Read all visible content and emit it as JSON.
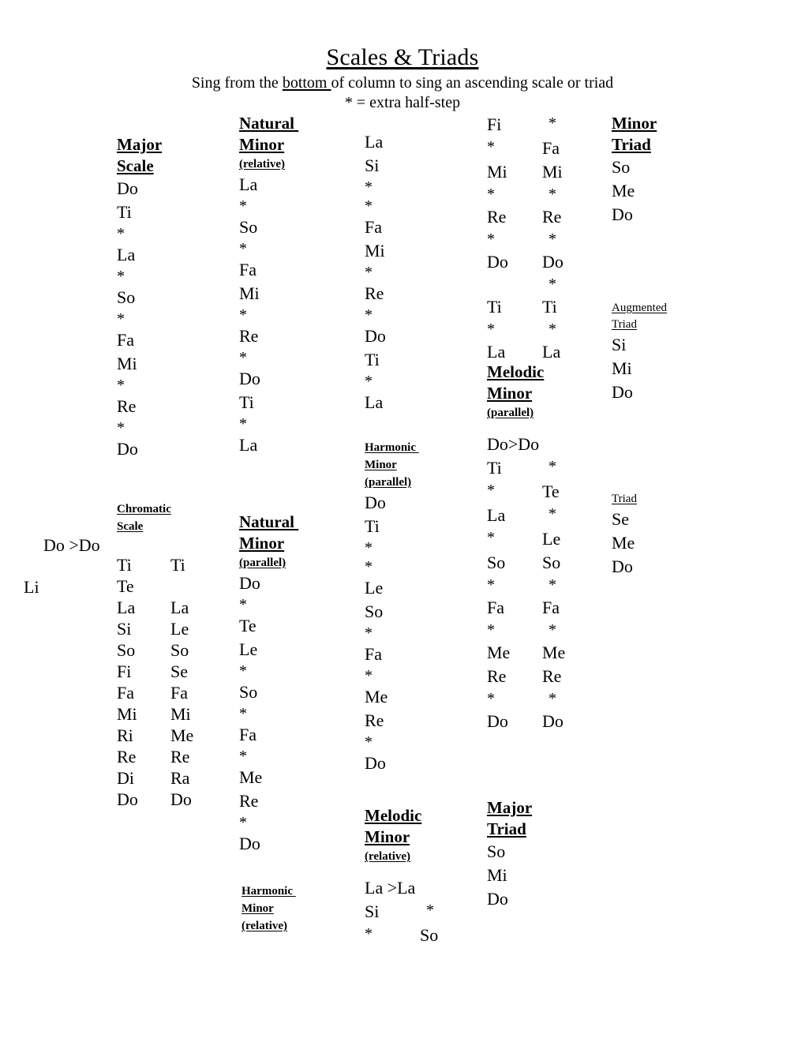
{
  "header": {
    "title": "Scales & Triads",
    "subtitle_pre": "Sing from the ",
    "subtitle_underline": "bottom ",
    "subtitle_post": "of column to sing an ascending scale or triad",
    "note": "* = extra half-step"
  },
  "col1": {
    "major_scale": {
      "title_line1": "Major",
      "title_line2": "Scale",
      "syllables": [
        "Do",
        "Ti",
        "*",
        "La",
        "*",
        "So",
        "*",
        "Fa",
        "Mi",
        "*",
        "Re",
        "*",
        "Do"
      ]
    },
    "chromatic_scale": {
      "title_line1": "Chromatic",
      "title_line2": "Scale",
      "range_label": "Do >Do",
      "side_label": "Li",
      "rows": [
        [
          "Ti",
          "Ti"
        ],
        [
          "Te",
          ""
        ],
        [
          "La",
          "La"
        ],
        [
          "Si",
          "Le"
        ],
        [
          "So",
          "So"
        ],
        [
          "Fi",
          "Se"
        ],
        [
          "Fa",
          "Fa"
        ],
        [
          "Mi",
          "Mi"
        ],
        [
          "Ri",
          "Me"
        ],
        [
          "Re",
          "Re"
        ],
        [
          "Di",
          "Ra"
        ],
        [
          "Do",
          "Do"
        ]
      ]
    }
  },
  "col2": {
    "natural_minor_relative": {
      "title_line1": "Natural ",
      "title_line2": "Minor",
      "subtitle": "(relative)",
      "syllables": [
        "La",
        "*",
        "So",
        "*",
        "Fa",
        "Mi",
        "*",
        "Re",
        "*",
        "Do",
        "Ti",
        "*",
        "La"
      ]
    },
    "natural_minor_parallel": {
      "title_line1": "Natural ",
      "title_line2": "Minor",
      "subtitle": "(parallel)",
      "syllables": [
        "Do",
        "*",
        "Te",
        "Le",
        "*",
        "So",
        "*",
        "Fa",
        "*",
        "Me",
        "Re",
        "*",
        "Do"
      ]
    },
    "harmonic_minor_relative": {
      "title_line1": "Harmonic ",
      "title_line2": "Minor",
      "subtitle": "(relative)"
    }
  },
  "col3": {
    "harmonic_minor_relative_values": {
      "syllables": [
        "La",
        "Si",
        "*",
        "*",
        "Fa",
        "Mi",
        "*",
        "Re",
        "*",
        "Do",
        "Ti",
        "*",
        "La"
      ]
    },
    "harmonic_minor_parallel": {
      "title_line1": "Harmonic ",
      "title_line2": "Minor",
      "subtitle": "(parallel)",
      "syllables": [
        "Do",
        "Ti",
        "*",
        "*",
        "Le",
        "So",
        "*",
        "Fa",
        "*",
        "Me",
        "Re",
        "*",
        "Do"
      ]
    },
    "melodic_minor_relative": {
      "title_line1": "Melodic",
      "title_line2": "Minor",
      "subtitle": "(relative)",
      "rows": [
        [
          "La >La",
          ""
        ],
        [
          "Si",
          "*"
        ],
        [
          "*",
          "So"
        ]
      ]
    }
  },
  "col4": {
    "melodic_minor_relative_values": {
      "rows": [
        [
          "Fi",
          "*"
        ],
        [
          "*",
          "Fa"
        ],
        [
          "Mi",
          "Mi"
        ],
        [
          "*",
          "*"
        ],
        [
          "Re",
          "Re"
        ],
        [
          "*",
          "*"
        ],
        [
          "Do",
          "Do"
        ],
        [
          "",
          "*"
        ],
        [
          "Ti",
          "Ti"
        ],
        [
          "*",
          "*"
        ],
        [
          "La",
          "La"
        ]
      ]
    },
    "melodic_minor_parallel": {
      "title_line1": "Melodic",
      "title_line2": "Minor",
      "subtitle": "(parallel)",
      "rows": [
        [
          "Do>Do",
          ""
        ],
        [
          "Ti",
          "*"
        ],
        [
          "*",
          "Te"
        ],
        [
          "La",
          "*"
        ],
        [
          "*",
          "Le"
        ],
        [
          "So",
          "So"
        ],
        [
          "*",
          "*"
        ],
        [
          "Fa",
          "Fa"
        ],
        [
          "*",
          "*"
        ],
        [
          "Me",
          "Me"
        ],
        [
          "Re",
          "Re"
        ],
        [
          "*",
          "*"
        ],
        [
          "Do",
          "Do"
        ]
      ]
    },
    "major_triad": {
      "title_line1": "Major",
      "title_line2": "Triad",
      "syllables": [
        "So",
        "Mi",
        "Do"
      ]
    }
  },
  "col5": {
    "minor_triad": {
      "title_line1": "Minor",
      "title_line2": "Triad",
      "syllables": [
        "So",
        "Me",
        "Do"
      ]
    },
    "augmented_triad": {
      "title_line1": "Augmented",
      "title_line2": "Triad",
      "syllables": [
        "Si",
        "Mi",
        "Do"
      ]
    },
    "diminished_triad": {
      "title_line1": "Triad",
      "syllables": [
        "Se",
        "Me",
        "Do"
      ]
    }
  }
}
